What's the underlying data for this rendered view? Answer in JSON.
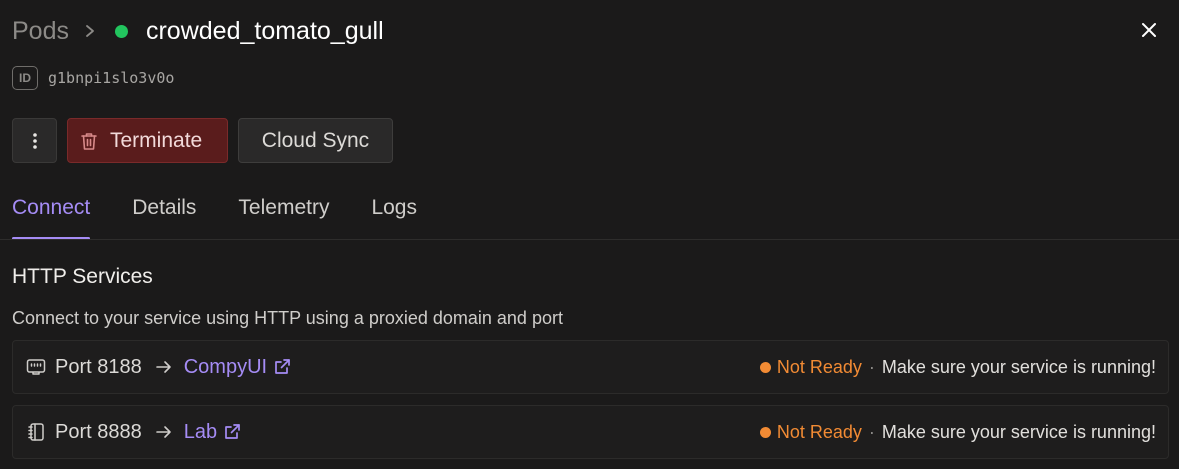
{
  "colors": {
    "running": "#22c55e",
    "accent": "#a58cf5",
    "not_ready": "#f28b34"
  },
  "breadcrumb": {
    "parent": "Pods",
    "separator_icon": "chevron-right-icon",
    "pod_name": "crowded_tomato_gull"
  },
  "pod": {
    "id_badge": "ID",
    "id": "g1bnpi1slo3v0o"
  },
  "actions": {
    "more_icon": "vertical-dots-icon",
    "terminate_label": "Terminate",
    "terminate_icon": "trash-icon",
    "cloud_sync_label": "Cloud Sync"
  },
  "tabs": [
    {
      "label": "Connect",
      "active": true
    },
    {
      "label": "Details",
      "active": false
    },
    {
      "label": "Telemetry",
      "active": false
    },
    {
      "label": "Logs",
      "active": false
    }
  ],
  "http_services": {
    "title": "HTTP Services",
    "description": "Connect to your service using HTTP using a proxied domain and port",
    "services": [
      {
        "icon": "ethernet-port-icon",
        "port_label": "Port 8188",
        "link_label": "CompyUI",
        "status": "Not Ready",
        "separator": "·",
        "message": "Make sure your service is running!"
      },
      {
        "icon": "notebook-icon",
        "port_label": "Port 8888",
        "link_label": "Lab",
        "status": "Not Ready",
        "separator": "·",
        "message": "Make sure your service is running!"
      }
    ]
  }
}
